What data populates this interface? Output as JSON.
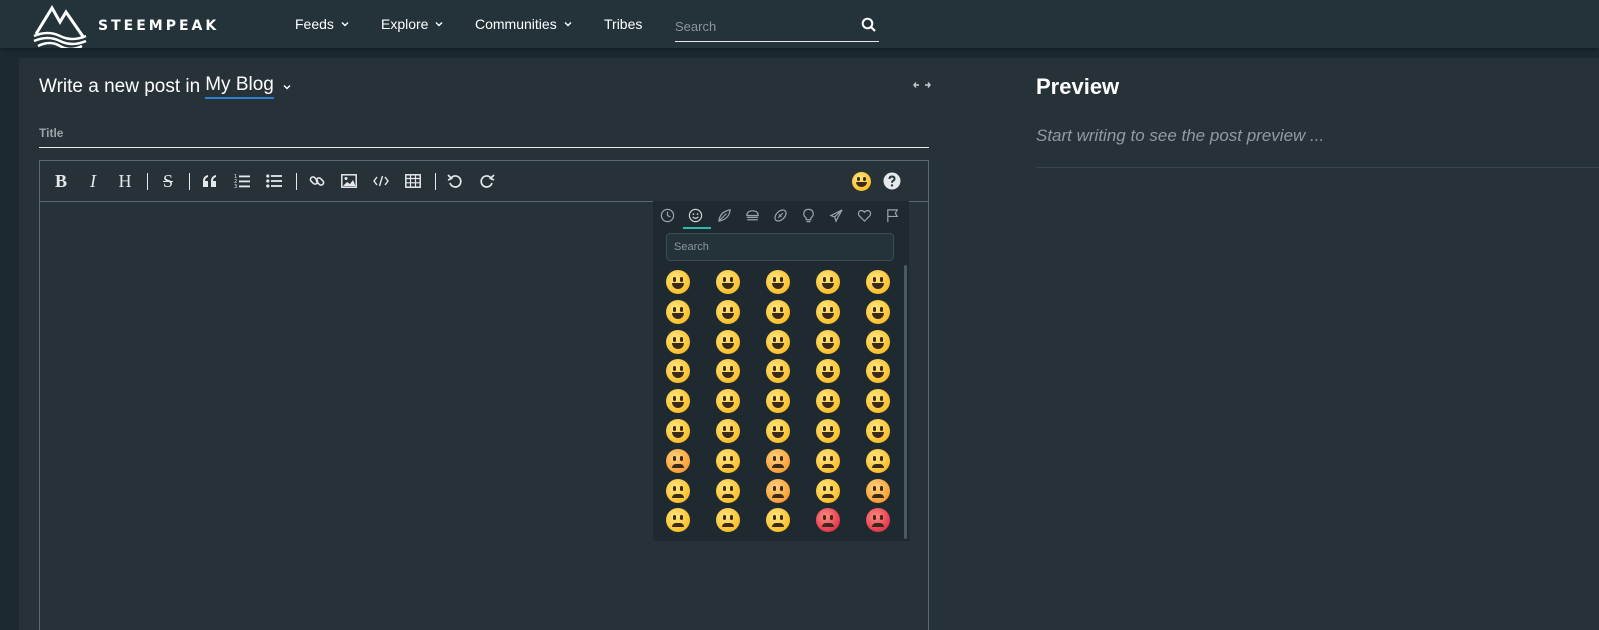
{
  "brand": {
    "name": "STEEMPEAK"
  },
  "nav": {
    "items": [
      {
        "label": "Feeds",
        "dropdown": true
      },
      {
        "label": "Explore",
        "dropdown": true
      },
      {
        "label": "Communities",
        "dropdown": true
      },
      {
        "label": "Tribes",
        "dropdown": false
      }
    ],
    "search_placeholder": "Search"
  },
  "editor": {
    "heading_prefix": "Write a new post in",
    "blog_name": "My Blog",
    "title_placeholder": "Title",
    "toolbar": [
      "bold",
      "italic",
      "heading",
      "strikethrough",
      "quote",
      "ordered-list",
      "unordered-list",
      "link",
      "image",
      "code",
      "table",
      "undo",
      "redo",
      "emoji",
      "help"
    ],
    "toolbar_glyphs": {
      "bold": "B",
      "italic": "I",
      "heading": "H",
      "strikethrough": "S"
    }
  },
  "emoji_picker": {
    "search_placeholder": "Search",
    "categories": [
      "recent",
      "smileys",
      "nature",
      "food",
      "activity",
      "objects",
      "travel",
      "symbols",
      "flags"
    ],
    "active_category": "smileys",
    "rows": 9,
    "cols": 5
  },
  "preview": {
    "title": "Preview",
    "hint": "Start writing to see the post preview ..."
  },
  "colors": {
    "accent": "#2bbbad",
    "link_underline": "#2f7fd6",
    "panel": "#263238",
    "nav": "#243239"
  }
}
